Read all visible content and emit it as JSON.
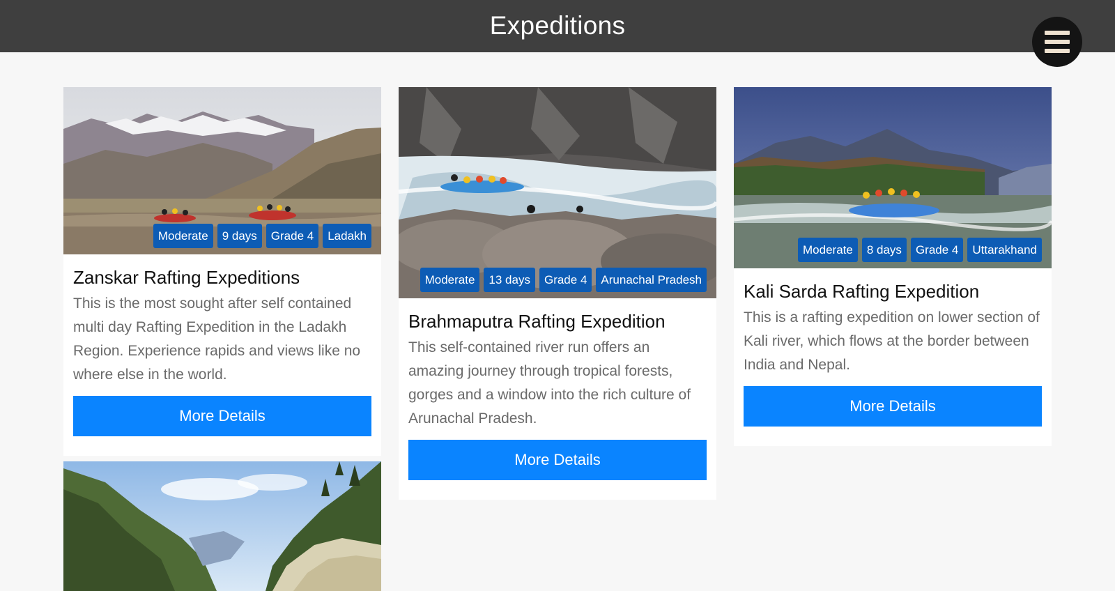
{
  "header": {
    "title": "Expeditions",
    "menu_icon": "hamburger-icon"
  },
  "cards": [
    {
      "title": "Zanskar Rafting Expeditions",
      "description": "This is the most sought after self contained multi day Rafting Expedition in the Ladakh Region. Experience rapids and views like no where else in the world.",
      "tags": [
        "Moderate",
        "9 days",
        "Grade 4",
        "Ladakh"
      ],
      "button": "More Details"
    },
    {
      "title": "Brahmaputra Rafting Expedition",
      "description": "This self-contained river run offers an amazing journey through tropical forests, gorges and a window into the rich culture of Arunachal Pradesh.",
      "tags": [
        "Moderate",
        "13 days",
        "Grade 4",
        "Arunachal Pradesh"
      ],
      "button": "More Details"
    },
    {
      "title": "Kali Sarda Rafting Expedition",
      "description": "This is a rafting expedition on lower section of Kali river, which flows at the border between India and Nepal.",
      "tags": [
        "Moderate",
        "8 days",
        "Grade 4",
        "Uttarakhand"
      ],
      "button": "More Details"
    }
  ],
  "colors": {
    "header_bg": "#3f3f3f",
    "tag_bg": "#0d5cb5",
    "button_bg": "#0a84ff",
    "page_bg": "#f7f7f7"
  }
}
